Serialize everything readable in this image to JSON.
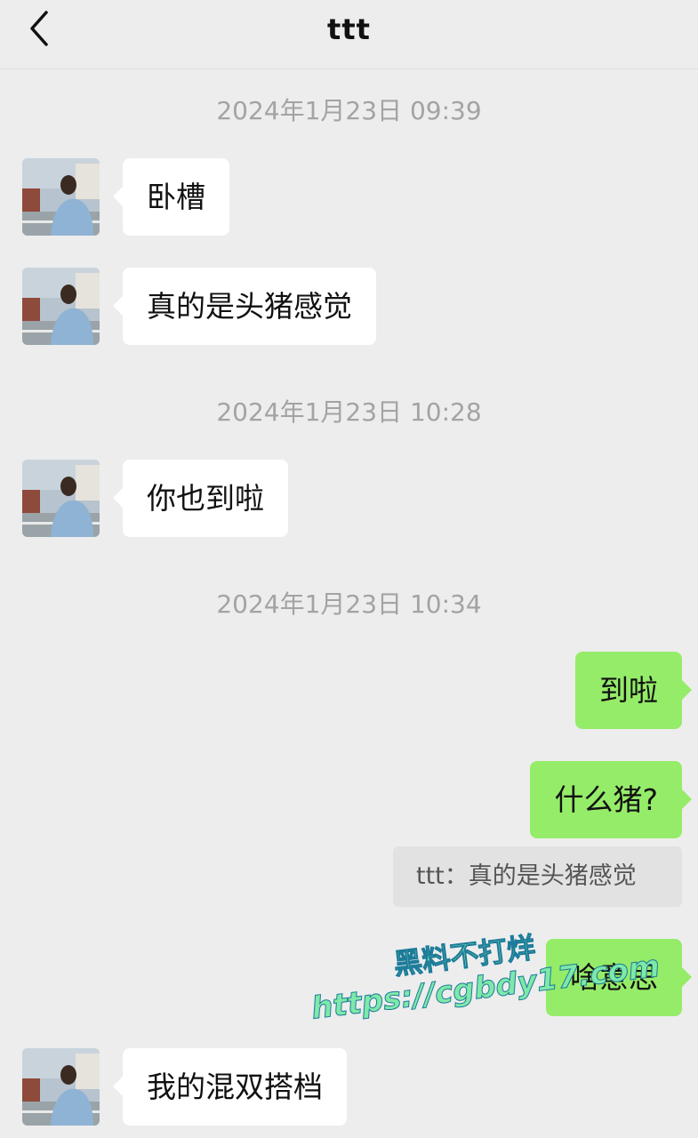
{
  "header": {
    "back_icon": "chevron-left-icon",
    "title": "ttt"
  },
  "chat": {
    "timestamps": [
      "2024年1月23日 09:39",
      "2024年1月23日 10:28",
      "2024年1月23日 10:34"
    ],
    "messages": [
      {
        "side": "incoming",
        "text": "卧槽"
      },
      {
        "side": "incoming",
        "text": "真的是头猪感觉"
      },
      {
        "side": "incoming",
        "text": "你也到啦"
      },
      {
        "side": "outgoing",
        "text": "到啦"
      },
      {
        "side": "outgoing",
        "text": "什么猪?"
      },
      {
        "side": "outgoing",
        "text": "啥意思"
      },
      {
        "side": "incoming",
        "text": "我的混双搭档"
      }
    ],
    "quote": {
      "text": "ttt：真的是头猪感觉"
    }
  },
  "watermark": {
    "line1": "黑料不打烊",
    "line2": "https://cgbdy17.com"
  },
  "colors": {
    "background": "#ededed",
    "incoming_bubble": "#ffffff",
    "outgoing_bubble": "#95ec69",
    "timestamp_text": "#a3a3a3",
    "quote_background": "#e2e2e2",
    "watermark_fill": "#7ee9a8",
    "watermark_stroke": "#1d7b9a"
  }
}
